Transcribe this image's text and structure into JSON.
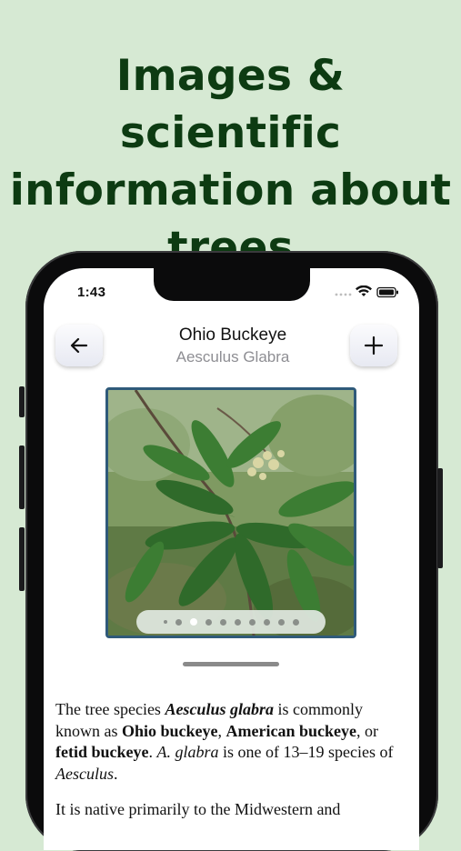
{
  "headline": {
    "lines": [
      "Images & scientific",
      "information about",
      "trees"
    ]
  },
  "status_bar": {
    "time": "1:43"
  },
  "nav": {
    "back_icon": "arrow-left-icon",
    "add_icon": "plus-icon",
    "title": "Ohio Buckeye",
    "subtitle": "Aesculus Glabra"
  },
  "gallery": {
    "image": "photo of Ohio buckeye leaves and flower cluster",
    "page_count": 11,
    "current_page": 3
  },
  "description": {
    "p1": {
      "t1": "The tree species ",
      "b1": "Aesculus glabra",
      "t2": " is commonly known as ",
      "b2": "Ohio buckeye",
      "t3": ", ",
      "b3": "American buckeye",
      "t4": ", or ",
      "b4": "fetid buckeye",
      "t5": ". ",
      "i1": "A. glabra",
      "t6": " is one of 13–19 species of ",
      "i2": "Aesculus",
      "t7": "."
    },
    "p2": "It is native primarily to the Midwestern and"
  },
  "colors": {
    "background": "#d6e9d3",
    "headline": "#0d3b12",
    "frame": "#2f5a7a"
  }
}
